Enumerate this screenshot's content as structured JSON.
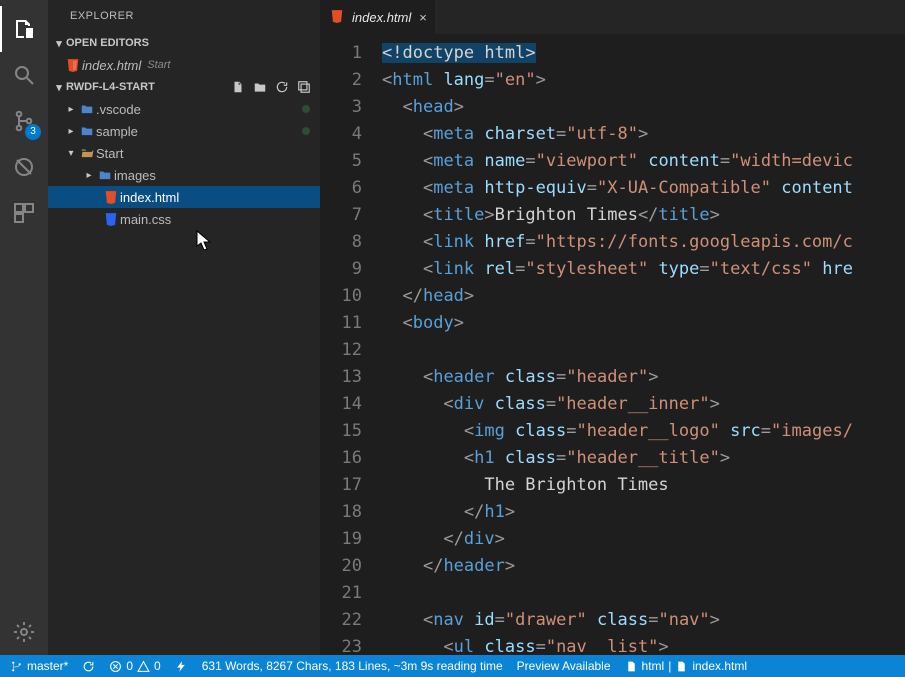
{
  "sidebar": {
    "title": "EXPLORER",
    "open_editors": {
      "label": "OPEN EDITORS",
      "items": [
        {
          "name": "index.html",
          "hint": "Start"
        }
      ]
    },
    "folder": {
      "label": "RWDF-L4-START",
      "tree": [
        {
          "name": ".vscode"
        },
        {
          "name": "sample"
        },
        {
          "name": "Start"
        },
        {
          "name": "images"
        },
        {
          "name": "index.html"
        },
        {
          "name": "main.css"
        }
      ]
    }
  },
  "activity": {
    "scm_badge": "3"
  },
  "tab": {
    "title": "index.html",
    "close": "×"
  },
  "code": {
    "lines": [
      [
        [
          "hi",
          "<"
        ],
        [
          "hi",
          "!doctype html"
        ],
        [
          "hi",
          ">"
        ]
      ],
      [
        [
          "pu",
          "<"
        ],
        [
          "tg",
          "html "
        ],
        [
          "at",
          "lang"
        ],
        [
          "pu",
          "="
        ],
        [
          "st",
          "\"en\""
        ],
        [
          "pu",
          ">"
        ]
      ],
      [
        [
          "tx",
          "  "
        ],
        [
          "pu",
          "<"
        ],
        [
          "tg",
          "head"
        ],
        [
          "pu",
          ">"
        ]
      ],
      [
        [
          "tx",
          "    "
        ],
        [
          "pu",
          "<"
        ],
        [
          "tg",
          "meta "
        ],
        [
          "at",
          "charset"
        ],
        [
          "pu",
          "="
        ],
        [
          "st",
          "\"utf-8\""
        ],
        [
          "pu",
          ">"
        ]
      ],
      [
        [
          "tx",
          "    "
        ],
        [
          "pu",
          "<"
        ],
        [
          "tg",
          "meta "
        ],
        [
          "at",
          "name"
        ],
        [
          "pu",
          "="
        ],
        [
          "st",
          "\"viewport\""
        ],
        [
          "tx",
          " "
        ],
        [
          "at",
          "content"
        ],
        [
          "pu",
          "="
        ],
        [
          "st",
          "\"width=devic"
        ]
      ],
      [
        [
          "tx",
          "    "
        ],
        [
          "pu",
          "<"
        ],
        [
          "tg",
          "meta "
        ],
        [
          "at",
          "http-equiv"
        ],
        [
          "pu",
          "="
        ],
        [
          "st",
          "\"X-UA-Compatible\""
        ],
        [
          "tx",
          " "
        ],
        [
          "at",
          "content"
        ]
      ],
      [
        [
          "tx",
          "    "
        ],
        [
          "pu",
          "<"
        ],
        [
          "tg",
          "title"
        ],
        [
          "pu",
          ">"
        ],
        [
          "tx",
          "Brighton Times"
        ],
        [
          "pu",
          "</"
        ],
        [
          "tg",
          "title"
        ],
        [
          "pu",
          ">"
        ]
      ],
      [
        [
          "tx",
          "    "
        ],
        [
          "pu",
          "<"
        ],
        [
          "tg",
          "link "
        ],
        [
          "at",
          "href"
        ],
        [
          "pu",
          "="
        ],
        [
          "st",
          "\"https://fonts.googleapis.com/c"
        ]
      ],
      [
        [
          "tx",
          "    "
        ],
        [
          "pu",
          "<"
        ],
        [
          "tg",
          "link "
        ],
        [
          "at",
          "rel"
        ],
        [
          "pu",
          "="
        ],
        [
          "st",
          "\"stylesheet\""
        ],
        [
          "tx",
          " "
        ],
        [
          "at",
          "type"
        ],
        [
          "pu",
          "="
        ],
        [
          "st",
          "\"text/css\""
        ],
        [
          "tx",
          " "
        ],
        [
          "at",
          "hre"
        ]
      ],
      [
        [
          "tx",
          "  "
        ],
        [
          "pu",
          "</"
        ],
        [
          "tg",
          "head"
        ],
        [
          "pu",
          ">"
        ]
      ],
      [
        [
          "tx",
          "  "
        ],
        [
          "pu",
          "<"
        ],
        [
          "tg",
          "body"
        ],
        [
          "pu",
          ">"
        ]
      ],
      [
        [
          "tx",
          " "
        ]
      ],
      [
        [
          "tx",
          "    "
        ],
        [
          "pu",
          "<"
        ],
        [
          "tg",
          "header "
        ],
        [
          "at",
          "class"
        ],
        [
          "pu",
          "="
        ],
        [
          "st",
          "\"header\""
        ],
        [
          "pu",
          ">"
        ]
      ],
      [
        [
          "tx",
          "      "
        ],
        [
          "pu",
          "<"
        ],
        [
          "tg",
          "div "
        ],
        [
          "at",
          "class"
        ],
        [
          "pu",
          "="
        ],
        [
          "st",
          "\"header__inner\""
        ],
        [
          "pu",
          ">"
        ]
      ],
      [
        [
          "tx",
          "        "
        ],
        [
          "pu",
          "<"
        ],
        [
          "tg",
          "img "
        ],
        [
          "at",
          "class"
        ],
        [
          "pu",
          "="
        ],
        [
          "st",
          "\"header__logo\""
        ],
        [
          "tx",
          " "
        ],
        [
          "at",
          "src"
        ],
        [
          "pu",
          "="
        ],
        [
          "st",
          "\"images/"
        ]
      ],
      [
        [
          "tx",
          "        "
        ],
        [
          "pu",
          "<"
        ],
        [
          "tg",
          "h1 "
        ],
        [
          "at",
          "class"
        ],
        [
          "pu",
          "="
        ],
        [
          "st",
          "\"header__title\""
        ],
        [
          "pu",
          ">"
        ]
      ],
      [
        [
          "tx",
          "          The Brighton Times"
        ]
      ],
      [
        [
          "tx",
          "        "
        ],
        [
          "pu",
          "</"
        ],
        [
          "tg",
          "h1"
        ],
        [
          "pu",
          ">"
        ]
      ],
      [
        [
          "tx",
          "      "
        ],
        [
          "pu",
          "</"
        ],
        [
          "tg",
          "div"
        ],
        [
          "pu",
          ">"
        ]
      ],
      [
        [
          "tx",
          "    "
        ],
        [
          "pu",
          "</"
        ],
        [
          "tg",
          "header"
        ],
        [
          "pu",
          ">"
        ]
      ],
      [
        [
          "tx",
          " "
        ]
      ],
      [
        [
          "tx",
          "    "
        ],
        [
          "pu",
          "<"
        ],
        [
          "tg",
          "nav "
        ],
        [
          "at",
          "id"
        ],
        [
          "pu",
          "="
        ],
        [
          "st",
          "\"drawer\""
        ],
        [
          "tx",
          " "
        ],
        [
          "at",
          "class"
        ],
        [
          "pu",
          "="
        ],
        [
          "st",
          "\"nav\""
        ],
        [
          "pu",
          ">"
        ]
      ],
      [
        [
          "tx",
          "      "
        ],
        [
          "pu",
          "<"
        ],
        [
          "tg",
          "ul "
        ],
        [
          "at",
          "class"
        ],
        [
          "pu",
          "="
        ],
        [
          "st",
          "\"nav__list\""
        ],
        [
          "pu",
          ">"
        ]
      ]
    ]
  },
  "status": {
    "branch": "master*",
    "errors": "0",
    "warnings": "0",
    "reading": "631 Words, 8267 Chars, 183 Lines, ~3m 9s reading time",
    "preview": "Preview Available",
    "lang": "html",
    "file": "index.html"
  }
}
